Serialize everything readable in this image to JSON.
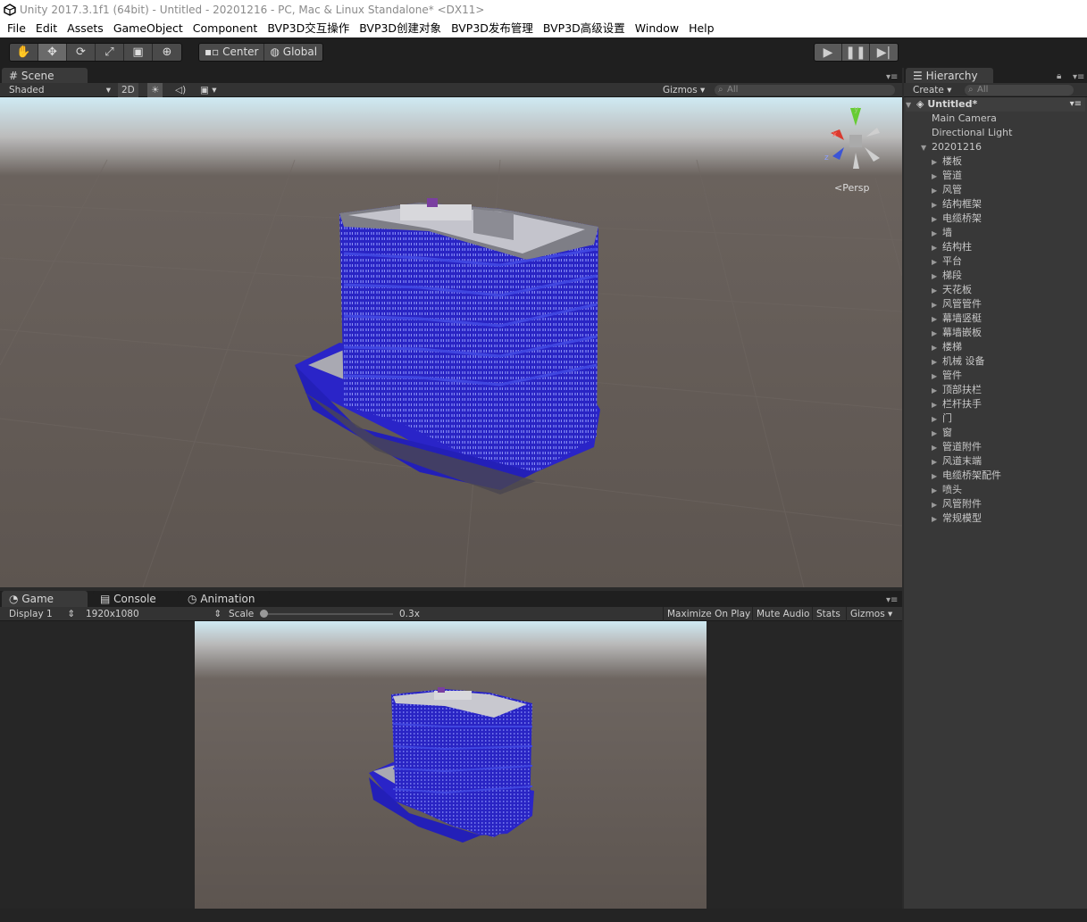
{
  "window": {
    "title": "Unity 2017.3.1f1 (64bit) - Untitled - 20201216 - PC, Mac & Linux Standalone* <DX11>"
  },
  "menu": [
    "File",
    "Edit",
    "Assets",
    "GameObject",
    "Component",
    "BVP3D交互操作",
    "BVP3D创建对象",
    "BVP3D发布管理",
    "BVP3D高级设置",
    "Window",
    "Help"
  ],
  "toolbar": {
    "tools": [
      "hand-tool-icon",
      "move-tool-icon",
      "rotate-tool-icon",
      "scale-tool-icon",
      "rect-tool-icon",
      "transform-tool-icon"
    ],
    "pivot": "Center",
    "space": "Global",
    "play_icons": [
      "play-icon",
      "pause-icon",
      "step-icon"
    ]
  },
  "scene": {
    "tab": "Scene",
    "shading": "Shaded",
    "mode2d": "2D",
    "gizmos": "Gizmos",
    "search_placeholder": "All",
    "persp": "Persp",
    "axis_x": "x",
    "axis_y": "y",
    "axis_z": "z"
  },
  "bottom_tabs": [
    "Game",
    "Console",
    "Animation"
  ],
  "game": {
    "display": "Display 1",
    "resolution": "1920x1080",
    "scale_label": "Scale",
    "scale_value": "0.3x",
    "maximize": "Maximize On Play",
    "mute": "Mute Audio",
    "stats": "Stats",
    "gizmos": "Gizmos"
  },
  "hierarchy": {
    "tab": "Hierarchy",
    "create": "Create",
    "search_placeholder": "All",
    "scene_name": "Untitled*",
    "root_items": [
      "Main Camera",
      "Directional Light"
    ],
    "group": "20201216",
    "children": [
      "楼板",
      "管道",
      "风管",
      "结构框架",
      "电缆桥架",
      "墙",
      "结构柱",
      "平台",
      "梯段",
      "天花板",
      "风管管件",
      "幕墙竖梃",
      "幕墙嵌板",
      "楼梯",
      "机械 设备",
      "管件",
      "顶部扶栏",
      "栏杆扶手",
      "门",
      "窗",
      "管道附件",
      "风道末端",
      "电缆桥架配件",
      "喷头",
      "风管附件",
      "常规模型"
    ]
  },
  "colors": {
    "building_blue": "#2a24c8",
    "ground": "#5e5651",
    "sky": "#cde9f2"
  }
}
